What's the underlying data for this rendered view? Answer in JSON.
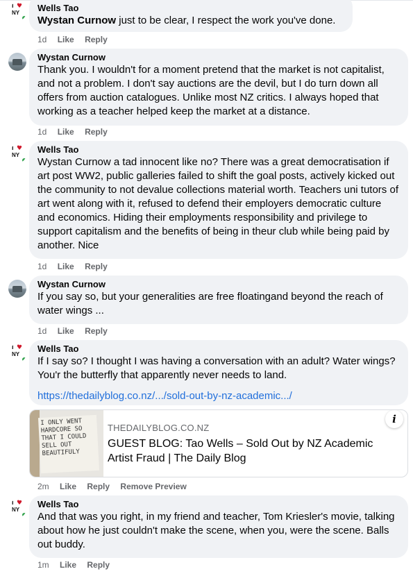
{
  "comments": [
    {
      "author": "Wells Tao",
      "mention": "Wystan Curnow",
      "text": " just to be clear, I respect the work you've done.",
      "time": "1d",
      "like": "Like",
      "reply": "Reply"
    },
    {
      "author": "Wystan Curnow",
      "text": "Thank you. I wouldn't for a moment pretend that the market is not capitalist, and not a problem. I don't say auctions are the devil, but I do turn down all offers from auction catalogues. Unlike most NZ critics. I always hoped that working as a teacher helped keep the market at a distance.",
      "time": "1d",
      "like": "Like",
      "reply": "Reply"
    },
    {
      "author": "Wells Tao",
      "text": "Wystan Curnow a tad innocent like no? There was a great democratisation if art post WW2, public galleries failed to shift the goal posts, actively kicked out the community to not devalue collections material worth. Teachers uni tutors of art went along with it, refused to defend their employers democratic culture and economics. Hiding their employments responsibility and privilege to support capitalism and the benefits of being in theur club while being paid by another. Nice",
      "time": "1d",
      "like": "Like",
      "reply": "Reply"
    },
    {
      "author": "Wystan Curnow",
      "text": "If you say so, but your generalities are free floatingand beyond the reach of water wings ...",
      "time": "1d",
      "like": "Like",
      "reply": "Reply"
    },
    {
      "author": "Wells Tao",
      "text": "If I say so? I thought I was having a conversation with an adult? Water wings? You'r the butterfly that apparently never needs to land.",
      "link": "https://thedailyblog.co.nz/.../sold-out-by-nz-academic.../",
      "time": "2m",
      "like": "Like",
      "reply": "Reply",
      "remove_preview": "Remove Preview"
    },
    {
      "author": "Wells Tao",
      "text": "And that was you right, in my friend and teacher, Tom Kriesler's movie, talking about how he just couldn't make the scene, when you, were the scene. Balls out buddy.",
      "time": "1m",
      "like": "Like",
      "reply": "Reply"
    }
  ],
  "preview": {
    "site": "THEDAILYBLOG.CO.NZ",
    "title": "GUEST BLOG: Tao Wells – Sold Out by NZ Academic Artist Fraud | The Daily Blog",
    "info_icon": "i",
    "thumb_text": "I ONLY WENT HARDCORE SO THAT I COULD SELL OUT BEAUTIFULY"
  },
  "avatar_text": {
    "top": "I",
    "bottom": "NY"
  }
}
